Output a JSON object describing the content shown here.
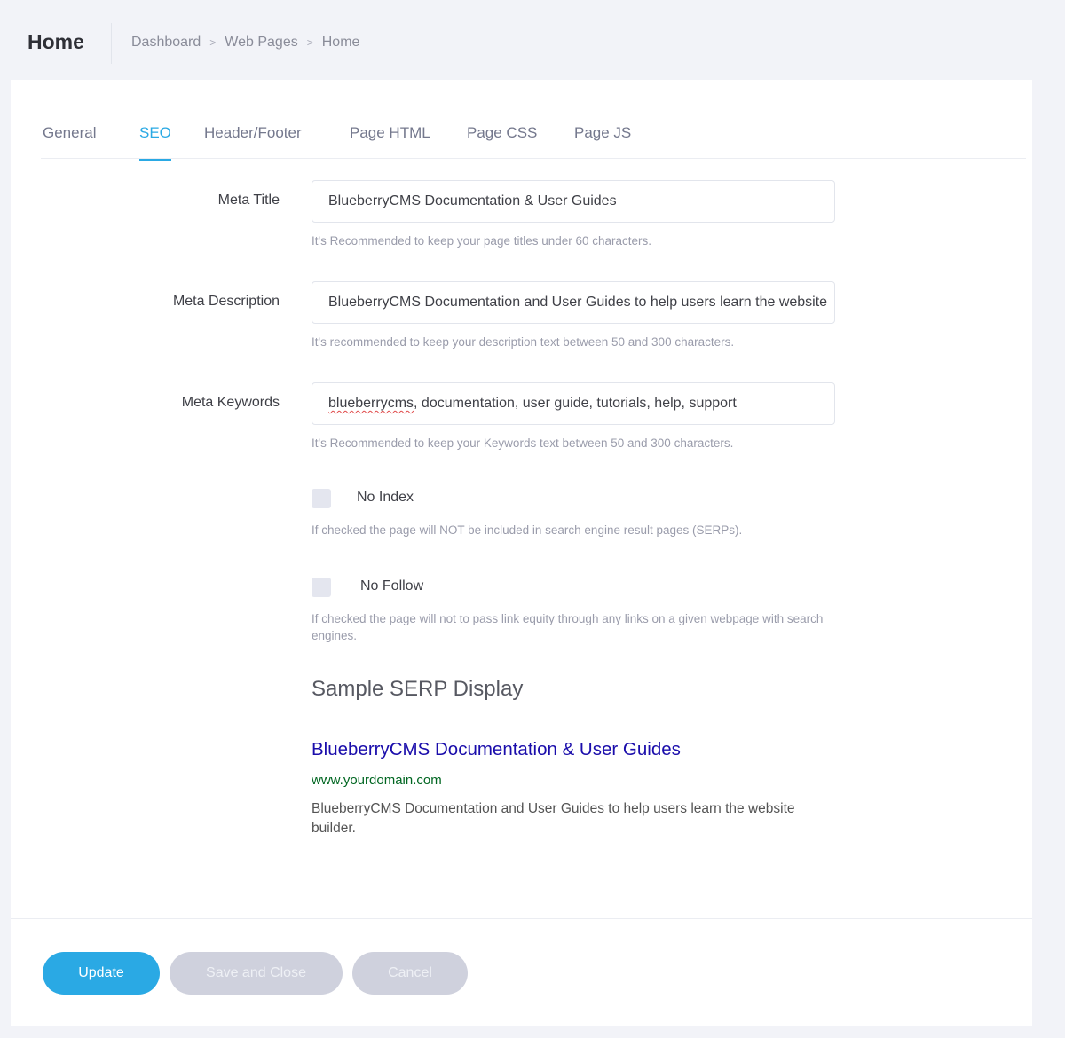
{
  "header": {
    "title": "Home",
    "breadcrumb": [
      "Dashboard",
      "Web Pages",
      "Home"
    ]
  },
  "tabs": [
    {
      "label": "General",
      "active": false
    },
    {
      "label": "SEO",
      "active": true
    },
    {
      "label": "Header/Footer",
      "active": false
    },
    {
      "label": "Page HTML",
      "active": false
    },
    {
      "label": "Page CSS",
      "active": false
    },
    {
      "label": "Page JS",
      "active": false
    }
  ],
  "form": {
    "meta_title": {
      "label": "Meta Title",
      "value": "BlueberryCMS Documentation & User Guides",
      "help": "It's Recommended to keep your page titles under 60 characters."
    },
    "meta_description": {
      "label": "Meta Description",
      "value": "BlueberryCMS Documentation and User Guides to help users learn the website",
      "help": "It's recommended to keep your description text between 50 and 300 characters."
    },
    "meta_keywords": {
      "label": "Meta Keywords",
      "value_misspelled": "blueberrycms",
      "value_rest": ", documentation, user guide, tutorials, help, support",
      "help": "It's Recommended to keep your Keywords text between 50 and 300 characters."
    },
    "no_index": {
      "label": "No Index",
      "checked": false,
      "help": "If checked the page will NOT be included in search engine result pages (SERPs)."
    },
    "no_follow": {
      "label": "No Follow",
      "checked": false,
      "help": "If checked the page will not to pass link equity through any links on a given webpage with search engines."
    }
  },
  "serp": {
    "heading": "Sample SERP Display",
    "title": "BlueberryCMS Documentation & User Guides",
    "url": "www.yourdomain.com",
    "description": "BlueberryCMS Documentation and User Guides to help users learn the website builder."
  },
  "footer": {
    "update_label": "Update",
    "save_close_label": "Save and Close",
    "cancel_label": "Cancel"
  },
  "colors": {
    "accent": "#2aa9e4",
    "serp_title": "#1a0dab",
    "serp_url": "#006621",
    "disabled_button": "#cfd1dd"
  }
}
